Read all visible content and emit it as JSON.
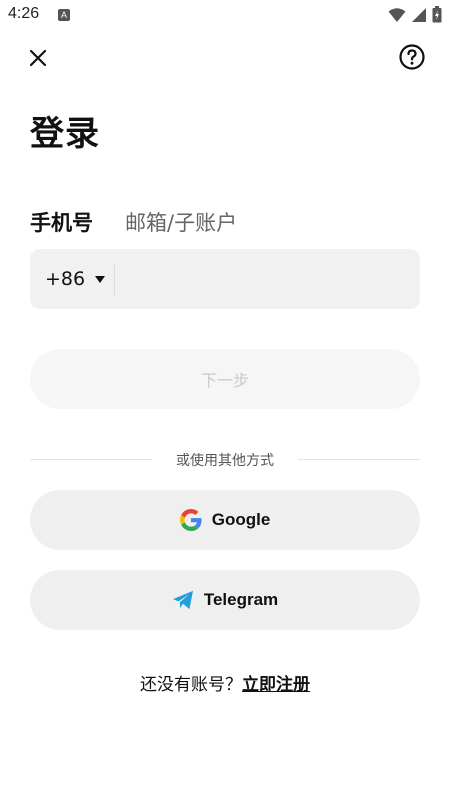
{
  "status_bar": {
    "time": "4:26",
    "app_icon_letter": "A"
  },
  "header": {
    "close_icon": "close-icon",
    "help_icon": "help-icon"
  },
  "page": {
    "title": "登录"
  },
  "tabs": [
    {
      "label": "手机号",
      "active": true
    },
    {
      "label": "邮箱/子账户",
      "active": false
    }
  ],
  "phone": {
    "country_code": "+86",
    "value": "",
    "placeholder": ""
  },
  "next_button": {
    "label": "下一步"
  },
  "divider": {
    "label": "或使用其他方式"
  },
  "social": {
    "google_label": "Google",
    "telegram_label": "Telegram"
  },
  "signup": {
    "prompt": "还没有账号？",
    "link": "立即注册"
  },
  "colors": {
    "field_bg": "#f1f1f1",
    "button_bg": "#efefef",
    "disabled_text": "#c9c9c9",
    "telegram_blue": "#229ED9"
  }
}
